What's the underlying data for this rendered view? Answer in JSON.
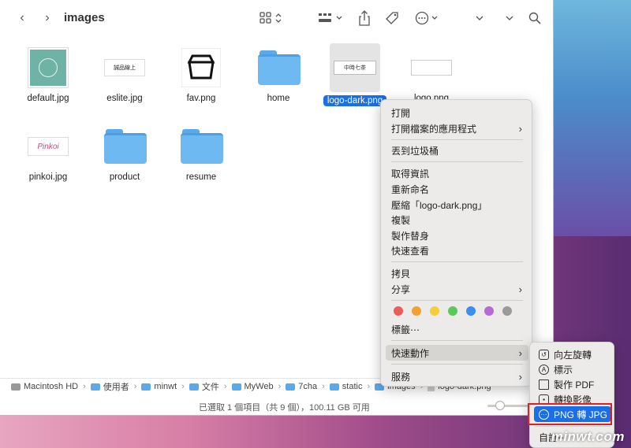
{
  "window": {
    "title": "images",
    "toolbar": {
      "back_icon": "chevron-left-icon",
      "forward_icon": "chevron-right-icon",
      "view_icon": "grid-view-icon",
      "group_icon": "group-icon",
      "share_icon": "share-icon",
      "tag_icon": "tag-icon",
      "action_icon": "more-icon",
      "search_icon": "search-icon"
    }
  },
  "files": [
    {
      "name": "default.jpg",
      "kind": "image"
    },
    {
      "name": "eslite.jpg",
      "kind": "image",
      "thumb_text": "誠品線上"
    },
    {
      "name": "fav.png",
      "kind": "image"
    },
    {
      "name": "home",
      "kind": "folder"
    },
    {
      "name": "logo-dark.png",
      "kind": "image",
      "selected": true,
      "thumb_text": "中時七茶"
    },
    {
      "name": "logo.png",
      "kind": "image"
    },
    {
      "name": "pinkoi.jpg",
      "kind": "image",
      "thumb_text": "Pinkoi"
    },
    {
      "name": "product",
      "kind": "folder"
    },
    {
      "name": "resume",
      "kind": "folder"
    }
  ],
  "pathbar": [
    "Macintosh HD",
    "使用者",
    "minwt",
    "文件",
    "MyWeb",
    "7cha",
    "static",
    "images",
    "logo-dark.png"
  ],
  "status": "已選取 1 個項目（共 9 個），100.11 GB 可用",
  "context_menu": {
    "open": "打開",
    "open_with": "打開檔案的應用程式",
    "trash": "丟到垃圾桶",
    "get_info": "取得資訊",
    "rename": "重新命名",
    "compress": "壓縮「logo-dark.png」",
    "duplicate": "複製",
    "make_alias": "製作替身",
    "quick_look": "快速查看",
    "copy": "拷貝",
    "share": "分享",
    "tags": "標籤⋯",
    "quick_actions": "快速動作",
    "services": "服務",
    "tag_colors": [
      "#ec5b56",
      "#f3a035",
      "#f5ce3c",
      "#5bc85a",
      "#3b8ef0",
      "#b66ad6",
      "#9a9a9a"
    ]
  },
  "submenu": {
    "rotate_left": "向左旋轉",
    "markup": "標示",
    "create_pdf": "製作 PDF",
    "convert_image": "轉換影像",
    "png_to_jpg": "PNG 轉 JPG",
    "customize": "自訂⋯"
  },
  "watermark": "minwt.com"
}
